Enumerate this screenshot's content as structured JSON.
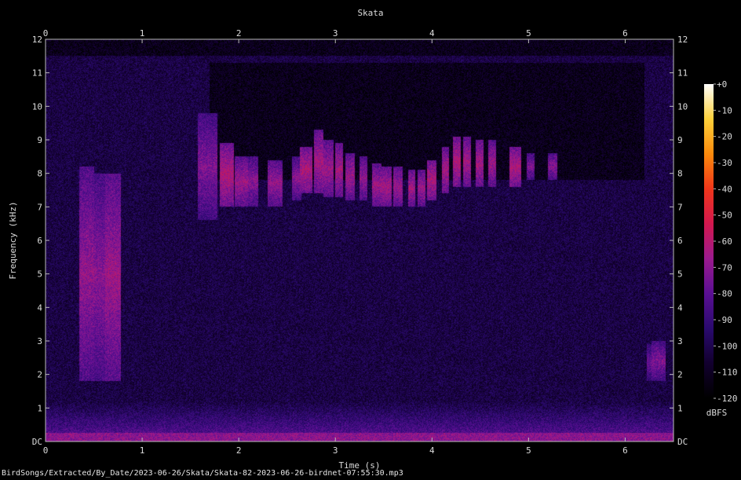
{
  "chart_data": {
    "type": "heatmap",
    "title": "Skata",
    "xlabel": "Time (s)",
    "ylabel": "Frequency (kHz)",
    "xlim": [
      0,
      6.5
    ],
    "ylim": [
      0,
      12
    ],
    "x_ticks": [
      {
        "v": 0,
        "label": "0"
      },
      {
        "v": 1,
        "label": "1"
      },
      {
        "v": 2,
        "label": "2"
      },
      {
        "v": 3,
        "label": "3"
      },
      {
        "v": 4,
        "label": "4"
      },
      {
        "v": 5,
        "label": "5"
      },
      {
        "v": 6,
        "label": "6"
      }
    ],
    "y_ticks": [
      {
        "v": 0,
        "label": "DC"
      },
      {
        "v": 1,
        "label": "1"
      },
      {
        "v": 2,
        "label": "2"
      },
      {
        "v": 3,
        "label": "3"
      },
      {
        "v": 4,
        "label": "4"
      },
      {
        "v": 5,
        "label": "5"
      },
      {
        "v": 6,
        "label": "6"
      },
      {
        "v": 7,
        "label": "7"
      },
      {
        "v": 8,
        "label": "8"
      },
      {
        "v": 9,
        "label": "9"
      },
      {
        "v": 10,
        "label": "10"
      },
      {
        "v": 11,
        "label": "11"
      },
      {
        "v": 12,
        "label": "12"
      }
    ],
    "colorbar": {
      "unit": "dBFS",
      "range": [
        -120,
        0
      ],
      "ticks": [
        {
          "v": 0,
          "label": "+0"
        },
        {
          "v": -10,
          "label": "-10"
        },
        {
          "v": -20,
          "label": "-20"
        },
        {
          "v": -30,
          "label": "-30"
        },
        {
          "v": -40,
          "label": "-40"
        },
        {
          "v": -50,
          "label": "-50"
        },
        {
          "v": -60,
          "label": "-60"
        },
        {
          "v": -70,
          "label": "-70"
        },
        {
          "v": -80,
          "label": "-80"
        },
        {
          "v": -90,
          "label": "-90"
        },
        {
          "v": -100,
          "label": "-100"
        },
        {
          "v": -110,
          "label": "-110"
        },
        {
          "v": -120,
          "label": "-120"
        }
      ],
      "colors": [
        "#000000",
        "#12002e",
        "#2a0a6e",
        "#5a0f93",
        "#9a1a8e",
        "#d3184e",
        "#f0361a",
        "#fb8a0c",
        "#fdd03a",
        "#ffffff"
      ]
    },
    "background_level_db": -102,
    "low_band": {
      "f_max": 1.2,
      "level_db": -78
    },
    "quiet_band": {
      "t": [
        1.7,
        6.2
      ],
      "f": [
        7.8,
        11.3
      ],
      "level_db": -112
    },
    "events": [
      {
        "t": [
          0.35,
          0.5
        ],
        "f": [
          1.8,
          8.2
        ],
        "level_db": -68
      },
      {
        "t": [
          0.5,
          0.63
        ],
        "f": [
          1.8,
          8.0
        ],
        "level_db": -70
      },
      {
        "t": [
          0.62,
          0.78
        ],
        "f": [
          1.8,
          8.0
        ],
        "level_db": -66
      },
      {
        "t": [
          1.58,
          1.78
        ],
        "f": [
          6.6,
          9.8
        ],
        "level_db": -72
      },
      {
        "t": [
          1.8,
          1.95
        ],
        "f": [
          7.0,
          8.9
        ],
        "level_db": -62
      },
      {
        "t": [
          1.96,
          2.1
        ],
        "f": [
          7.0,
          8.5
        ],
        "level_db": -66
      },
      {
        "t": [
          2.1,
          2.2
        ],
        "f": [
          7.0,
          8.5
        ],
        "level_db": -70
      },
      {
        "t": [
          2.3,
          2.45
        ],
        "f": [
          7.0,
          8.4
        ],
        "level_db": -68
      },
      {
        "t": [
          2.55,
          2.65
        ],
        "f": [
          7.2,
          8.5
        ],
        "level_db": -70
      },
      {
        "t": [
          2.63,
          2.76
        ],
        "f": [
          7.4,
          8.8
        ],
        "level_db": -62
      },
      {
        "t": [
          2.78,
          2.88
        ],
        "f": [
          7.4,
          9.3
        ],
        "level_db": -64
      },
      {
        "t": [
          2.88,
          2.98
        ],
        "f": [
          7.3,
          9.0
        ],
        "level_db": -66
      },
      {
        "t": [
          3.0,
          3.08
        ],
        "f": [
          7.3,
          8.9
        ],
        "level_db": -64
      },
      {
        "t": [
          3.1,
          3.2
        ],
        "f": [
          7.2,
          8.6
        ],
        "level_db": -66
      },
      {
        "t": [
          3.25,
          3.33
        ],
        "f": [
          7.2,
          8.5
        ],
        "level_db": -68
      },
      {
        "t": [
          3.38,
          3.48
        ],
        "f": [
          7.0,
          8.3
        ],
        "level_db": -66
      },
      {
        "t": [
          3.48,
          3.58
        ],
        "f": [
          7.0,
          8.2
        ],
        "level_db": -64
      },
      {
        "t": [
          3.6,
          3.7
        ],
        "f": [
          7.0,
          8.2
        ],
        "level_db": -66
      },
      {
        "t": [
          3.75,
          3.83
        ],
        "f": [
          7.0,
          8.1
        ],
        "level_db": -64
      },
      {
        "t": [
          3.85,
          3.93
        ],
        "f": [
          7.0,
          8.1
        ],
        "level_db": -66
      },
      {
        "t": [
          3.95,
          4.05
        ],
        "f": [
          7.2,
          8.4
        ],
        "level_db": -62
      },
      {
        "t": [
          4.1,
          4.18
        ],
        "f": [
          7.4,
          8.8
        ],
        "level_db": -64
      },
      {
        "t": [
          4.22,
          4.3
        ],
        "f": [
          7.6,
          9.1
        ],
        "level_db": -62
      },
      {
        "t": [
          4.32,
          4.4
        ],
        "f": [
          7.6,
          9.1
        ],
        "level_db": -64
      },
      {
        "t": [
          4.45,
          4.53
        ],
        "f": [
          7.6,
          9.0
        ],
        "level_db": -64
      },
      {
        "t": [
          4.58,
          4.66
        ],
        "f": [
          7.6,
          9.0
        ],
        "level_db": -66
      },
      {
        "t": [
          4.8,
          4.92
        ],
        "f": [
          7.6,
          8.8
        ],
        "level_db": -62
      },
      {
        "t": [
          4.98,
          5.06
        ],
        "f": [
          7.8,
          8.6
        ],
        "level_db": -72
      },
      {
        "t": [
          5.2,
          5.3
        ],
        "f": [
          7.8,
          8.6
        ],
        "level_db": -70
      },
      {
        "t": [
          6.22,
          6.28
        ],
        "f": [
          1.8,
          2.9
        ],
        "level_db": -76
      },
      {
        "t": [
          6.27,
          6.42
        ],
        "f": [
          1.8,
          3.0
        ],
        "level_db": -72
      }
    ]
  },
  "footer": {
    "filename": "BirdSongs/Extracted/By_Date/2023-06-26/Skata/Skata-82-2023-06-26-birdnet-07:55:30.mp3"
  }
}
